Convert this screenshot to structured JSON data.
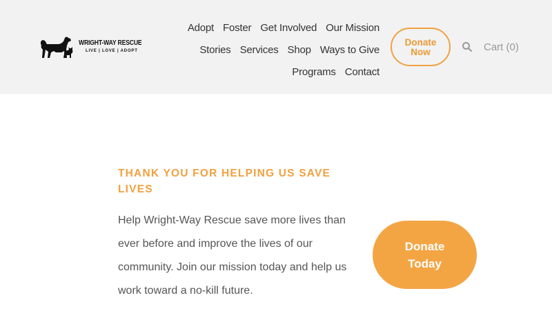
{
  "logo": {
    "name": "WRIGHT-WAY RESCUE",
    "tagline": "LIVE | LOVE | ADOPT",
    "icon": "dog-and-cat-silhouette"
  },
  "nav": {
    "row1": [
      "Adopt",
      "Foster",
      "Get Involved",
      "Our Mission"
    ],
    "row2": [
      "Stories",
      "Services",
      "Shop",
      "Ways to Give"
    ],
    "row3": [
      "Programs",
      "Contact"
    ]
  },
  "header_donate": {
    "line1": "Donate",
    "line2": "Now"
  },
  "search": {
    "icon": "search-icon"
  },
  "cart": {
    "label": "Cart (0)"
  },
  "main": {
    "heading": "THANK YOU FOR HELPING US SAVE LIVES",
    "body": "Help Wright-Way Rescue save more lives than ever before and improve the lives of our community. Join our mission today and help us work toward a no-kill future.",
    "donate_button": {
      "line1": "Donate",
      "line2": "Today"
    }
  },
  "colors": {
    "accent": "#f0a140",
    "header_bg": "#f2f2f2",
    "text": "#555555"
  }
}
